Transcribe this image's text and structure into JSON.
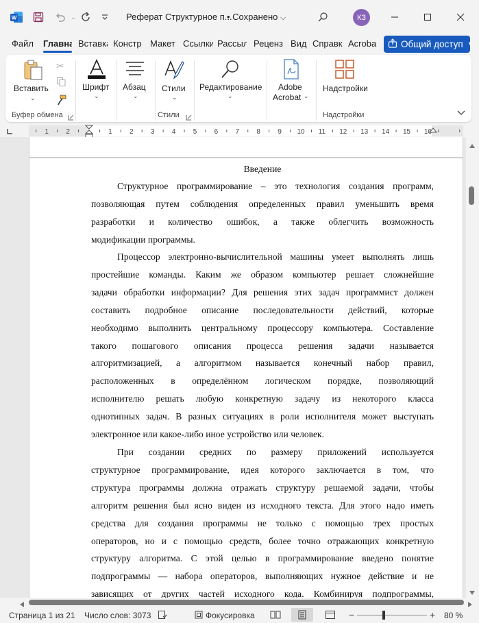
{
  "titlebar": {
    "doc_title": "Реферат Структурное п...",
    "saved_status": "• Сохранено",
    "avatar_initials": "КЗ",
    "app_icon": "word-icon",
    "accent": "#185abd"
  },
  "tabs": [
    "Файл",
    "Главна",
    "Вставка",
    "Констр",
    "Макет",
    "Ссылки",
    "Рассыл",
    "Реценз",
    "Вид",
    "Справк",
    "Acroba"
  ],
  "active_tab": "Главна",
  "share_label": "Общий доступ",
  "ribbon": {
    "paste": "Вставить",
    "font": "Шрифт",
    "paragraph": "Абзац",
    "styles": "Стили",
    "editing": "Редактирование",
    "adobe_line1": "Adobe",
    "adobe_line2": "Acrobat",
    "addins": "Надстройки",
    "group_clipboard": "Буфер обмена",
    "group_styles": "Стили",
    "group_addins": "Надстройки"
  },
  "ruler_numbers": [
    "1",
    "2",
    "1",
    "2",
    "3",
    "4",
    "5",
    "6",
    "7",
    "8",
    "9",
    "10",
    "11",
    "12",
    "13",
    "14",
    "15",
    "16"
  ],
  "document": {
    "heading": "Введение",
    "paragraphs": [
      [
        "Структурное программирование – это технология создания программ,",
        "позволяющая путем соблюдения определенных правил уменьшить время",
        "разработки и количество ошибок, а также облегчить возможность",
        "модификации программы."
      ],
      [
        "Процессор электронно-вычислительной машины умеет выполнять лишь",
        "простейшие команды. Каким же образом компьютер решает сложнейшие",
        "задачи обработки информации? Для решения этих задач программист должен",
        "составить подробное описание последовательности действий, которые",
        "необходимо выполнить центральному процессору компьютера. Составление",
        "такого пошагового описания процесса решения задачи называется",
        "алгоритмизацией, а алгоритмом называется конечный набор правил,",
        "расположенных в определённом логическом порядке, позволяющий",
        "исполнителю решать любую конкретную задачу из некоторого класса",
        "однотипных задач. В разных ситуациях в роли исполнителя может выступать",
        "электронное или какое-либо иное устройство или человек."
      ],
      [
        "При создании средних по размеру приложений используется",
        "структурное программирование, идея которого заключается в том, что",
        "структура программы должна отражать структуру решаемой задачи, чтобы",
        "алгоритм решения был ясно виден из исходного текста. Для этого надо иметь",
        "средства для создания программы не только с помощью трех простых",
        "операторов, но и с помощью средств, более точно отражающих конкретную",
        "структуру алгоритма. С этой целью в программирование введено понятие",
        "подпрограммы — набора операторов, выполняющих нужное действие и не",
        "зависящих от других частей исходного кода. Комбинируя подпрограммы,"
      ]
    ]
  },
  "statusbar": {
    "page": "Страница 1 из 21",
    "words": "Число слов: 3073",
    "focus": "Фокусировка",
    "zoom": "80 %"
  }
}
